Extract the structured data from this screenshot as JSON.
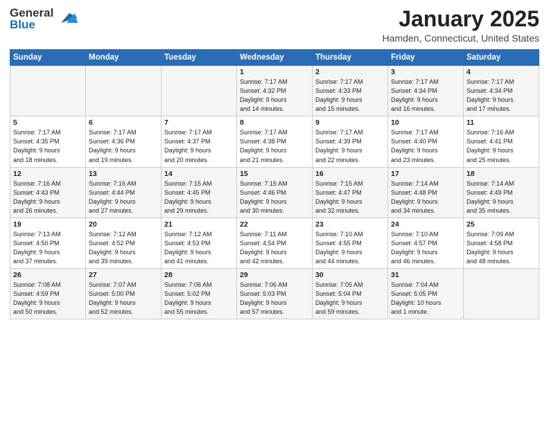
{
  "header": {
    "logo_general": "General",
    "logo_blue": "Blue",
    "month": "January 2025",
    "location": "Hamden, Connecticut, United States"
  },
  "weekdays": [
    "Sunday",
    "Monday",
    "Tuesday",
    "Wednesday",
    "Thursday",
    "Friday",
    "Saturday"
  ],
  "weeks": [
    [
      {
        "day": "",
        "info": ""
      },
      {
        "day": "",
        "info": ""
      },
      {
        "day": "",
        "info": ""
      },
      {
        "day": "1",
        "info": "Sunrise: 7:17 AM\nSunset: 4:32 PM\nDaylight: 9 hours\nand 14 minutes."
      },
      {
        "day": "2",
        "info": "Sunrise: 7:17 AM\nSunset: 4:33 PM\nDaylight: 9 hours\nand 15 minutes."
      },
      {
        "day": "3",
        "info": "Sunrise: 7:17 AM\nSunset: 4:34 PM\nDaylight: 9 hours\nand 16 minutes."
      },
      {
        "day": "4",
        "info": "Sunrise: 7:17 AM\nSunset: 4:34 PM\nDaylight: 9 hours\nand 17 minutes."
      }
    ],
    [
      {
        "day": "5",
        "info": "Sunrise: 7:17 AM\nSunset: 4:35 PM\nDaylight: 9 hours\nand 18 minutes."
      },
      {
        "day": "6",
        "info": "Sunrise: 7:17 AM\nSunset: 4:36 PM\nDaylight: 9 hours\nand 19 minutes."
      },
      {
        "day": "7",
        "info": "Sunrise: 7:17 AM\nSunset: 4:37 PM\nDaylight: 9 hours\nand 20 minutes."
      },
      {
        "day": "8",
        "info": "Sunrise: 7:17 AM\nSunset: 4:38 PM\nDaylight: 9 hours\nand 21 minutes."
      },
      {
        "day": "9",
        "info": "Sunrise: 7:17 AM\nSunset: 4:39 PM\nDaylight: 9 hours\nand 22 minutes."
      },
      {
        "day": "10",
        "info": "Sunrise: 7:17 AM\nSunset: 4:40 PM\nDaylight: 9 hours\nand 23 minutes."
      },
      {
        "day": "11",
        "info": "Sunrise: 7:16 AM\nSunset: 4:41 PM\nDaylight: 9 hours\nand 25 minutes."
      }
    ],
    [
      {
        "day": "12",
        "info": "Sunrise: 7:16 AM\nSunset: 4:43 PM\nDaylight: 9 hours\nand 26 minutes."
      },
      {
        "day": "13",
        "info": "Sunrise: 7:16 AM\nSunset: 4:44 PM\nDaylight: 9 hours\nand 27 minutes."
      },
      {
        "day": "14",
        "info": "Sunrise: 7:15 AM\nSunset: 4:45 PM\nDaylight: 9 hours\nand 29 minutes."
      },
      {
        "day": "15",
        "info": "Sunrise: 7:15 AM\nSunset: 4:46 PM\nDaylight: 9 hours\nand 30 minutes."
      },
      {
        "day": "16",
        "info": "Sunrise: 7:15 AM\nSunset: 4:47 PM\nDaylight: 9 hours\nand 32 minutes."
      },
      {
        "day": "17",
        "info": "Sunrise: 7:14 AM\nSunset: 4:48 PM\nDaylight: 9 hours\nand 34 minutes."
      },
      {
        "day": "18",
        "info": "Sunrise: 7:14 AM\nSunset: 4:49 PM\nDaylight: 9 hours\nand 35 minutes."
      }
    ],
    [
      {
        "day": "19",
        "info": "Sunrise: 7:13 AM\nSunset: 4:50 PM\nDaylight: 9 hours\nand 37 minutes."
      },
      {
        "day": "20",
        "info": "Sunrise: 7:12 AM\nSunset: 4:52 PM\nDaylight: 9 hours\nand 39 minutes."
      },
      {
        "day": "21",
        "info": "Sunrise: 7:12 AM\nSunset: 4:53 PM\nDaylight: 9 hours\nand 41 minutes."
      },
      {
        "day": "22",
        "info": "Sunrise: 7:11 AM\nSunset: 4:54 PM\nDaylight: 9 hours\nand 42 minutes."
      },
      {
        "day": "23",
        "info": "Sunrise: 7:10 AM\nSunset: 4:55 PM\nDaylight: 9 hours\nand 44 minutes."
      },
      {
        "day": "24",
        "info": "Sunrise: 7:10 AM\nSunset: 4:57 PM\nDaylight: 9 hours\nand 46 minutes."
      },
      {
        "day": "25",
        "info": "Sunrise: 7:09 AM\nSunset: 4:58 PM\nDaylight: 9 hours\nand 48 minutes."
      }
    ],
    [
      {
        "day": "26",
        "info": "Sunrise: 7:08 AM\nSunset: 4:59 PM\nDaylight: 9 hours\nand 50 minutes."
      },
      {
        "day": "27",
        "info": "Sunrise: 7:07 AM\nSunset: 5:00 PM\nDaylight: 9 hours\nand 52 minutes."
      },
      {
        "day": "28",
        "info": "Sunrise: 7:06 AM\nSunset: 5:02 PM\nDaylight: 9 hours\nand 55 minutes."
      },
      {
        "day": "29",
        "info": "Sunrise: 7:06 AM\nSunset: 5:03 PM\nDaylight: 9 hours\nand 57 minutes."
      },
      {
        "day": "30",
        "info": "Sunrise: 7:05 AM\nSunset: 5:04 PM\nDaylight: 9 hours\nand 59 minutes."
      },
      {
        "day": "31",
        "info": "Sunrise: 7:04 AM\nSunset: 5:05 PM\nDaylight: 10 hours\nand 1 minute."
      },
      {
        "day": "",
        "info": ""
      }
    ]
  ]
}
